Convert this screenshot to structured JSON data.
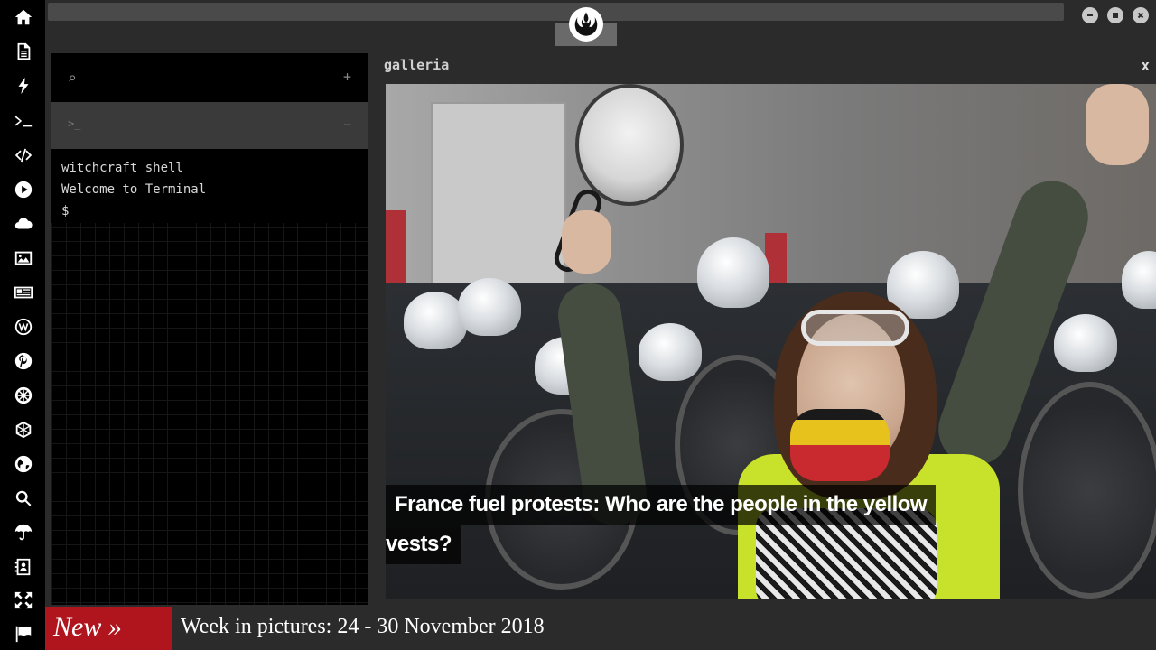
{
  "sidebar": {
    "icons": [
      "home-icon",
      "document-icon",
      "bolt-icon",
      "terminal-icon",
      "code-icon",
      "play-icon",
      "cloud-icon",
      "image-icon",
      "newspaper-icon",
      "wordpress-icon",
      "pinterest-icon",
      "rebel-icon",
      "hexagon-icon",
      "globe-icon",
      "search-icon",
      "umbrella-icon",
      "contacts-icon",
      "expand-icon",
      "flag-icon"
    ]
  },
  "terminal": {
    "search_icon": "⌕",
    "add_label": "+",
    "prompt_icon": ">_",
    "collapse_label": "−",
    "lines": [
      "witchcraft shell",
      "Welcome to Terminal",
      "$"
    ]
  },
  "gallery": {
    "title": "galleria",
    "close_label": "x",
    "caption_line1": "France fuel protests: Who are the people in the yellow",
    "caption_line2": "vests?"
  },
  "ticker": {
    "new_label": "New »",
    "headline": "Week in pictures: 24 - 30 November 2018"
  },
  "colors": {
    "sidebar_bg": "#000000",
    "ticker_red": "#b0141c",
    "window_bg": "#2b2b2b"
  }
}
